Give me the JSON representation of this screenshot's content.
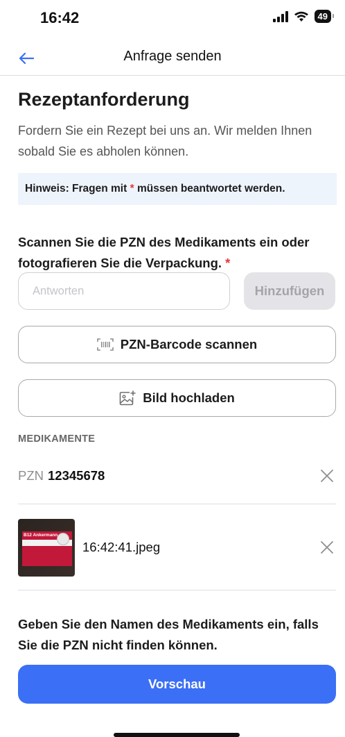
{
  "status_bar": {
    "time": "16:42",
    "battery": "49"
  },
  "nav": {
    "title": "Anfrage senden"
  },
  "page": {
    "title": "Rezeptanforderung",
    "intro": "Fordern Sie ein Rezept bei uns an. Wir melden Ihnen sobald Sie es abholen können.",
    "hint_prefix": "Hinweis: Fragen mit",
    "hint_star": "*",
    "hint_suffix": "müssen beantwortet werden."
  },
  "question": {
    "text": "Scannen Sie die PZN des Medikaments ein oder fotografieren Sie die Verpackung.",
    "required": "*"
  },
  "input": {
    "placeholder": "Antworten",
    "value": ""
  },
  "buttons": {
    "add": "Hinzufügen",
    "scan": "PZN-Barcode scannen",
    "upload": "Bild hochladen",
    "preview": "Vorschau"
  },
  "medications": {
    "section_label": "MEDIKAMENTE",
    "pzn_prefix": "PZN",
    "pzn_code": "12345678",
    "image_file": "16:42:41.jpeg",
    "thumb_brand": "B12 Ankermann"
  },
  "footer_question": "Geben Sie den Namen des Medikaments ein, falls Sie die PZN nicht finden können.",
  "colors": {
    "accent": "#3b6ff5",
    "required": "#e53935",
    "hint_bg": "#eef4fb"
  }
}
